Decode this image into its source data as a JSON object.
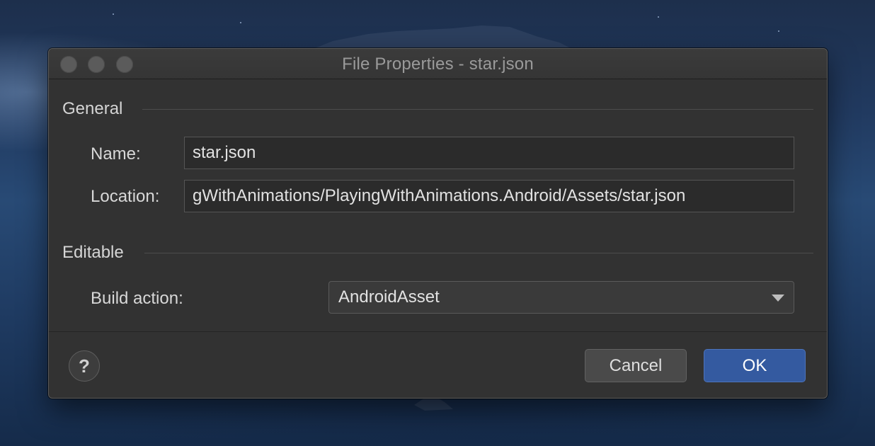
{
  "window": {
    "title": "File Properties - star.json"
  },
  "general": {
    "section_label": "General",
    "name_label": "Name:",
    "name_value": "star.json",
    "location_label": "Location:",
    "location_value": "gWithAnimations/PlayingWithAnimations.Android/Assets/star.json"
  },
  "editable": {
    "section_label": "Editable",
    "build_action_label": "Build action:",
    "build_action_value": "AndroidAsset"
  },
  "footer": {
    "help_label": "?",
    "cancel_label": "Cancel",
    "ok_label": "OK"
  },
  "colors": {
    "accent": "#345aa0",
    "window_bg": "#323232",
    "field_bg": "#2b2b2b"
  },
  "icons": {
    "traffic_lights": [
      "close-icon",
      "minimize-icon",
      "zoom-icon"
    ],
    "dropdown": "chevron-down-icon"
  }
}
